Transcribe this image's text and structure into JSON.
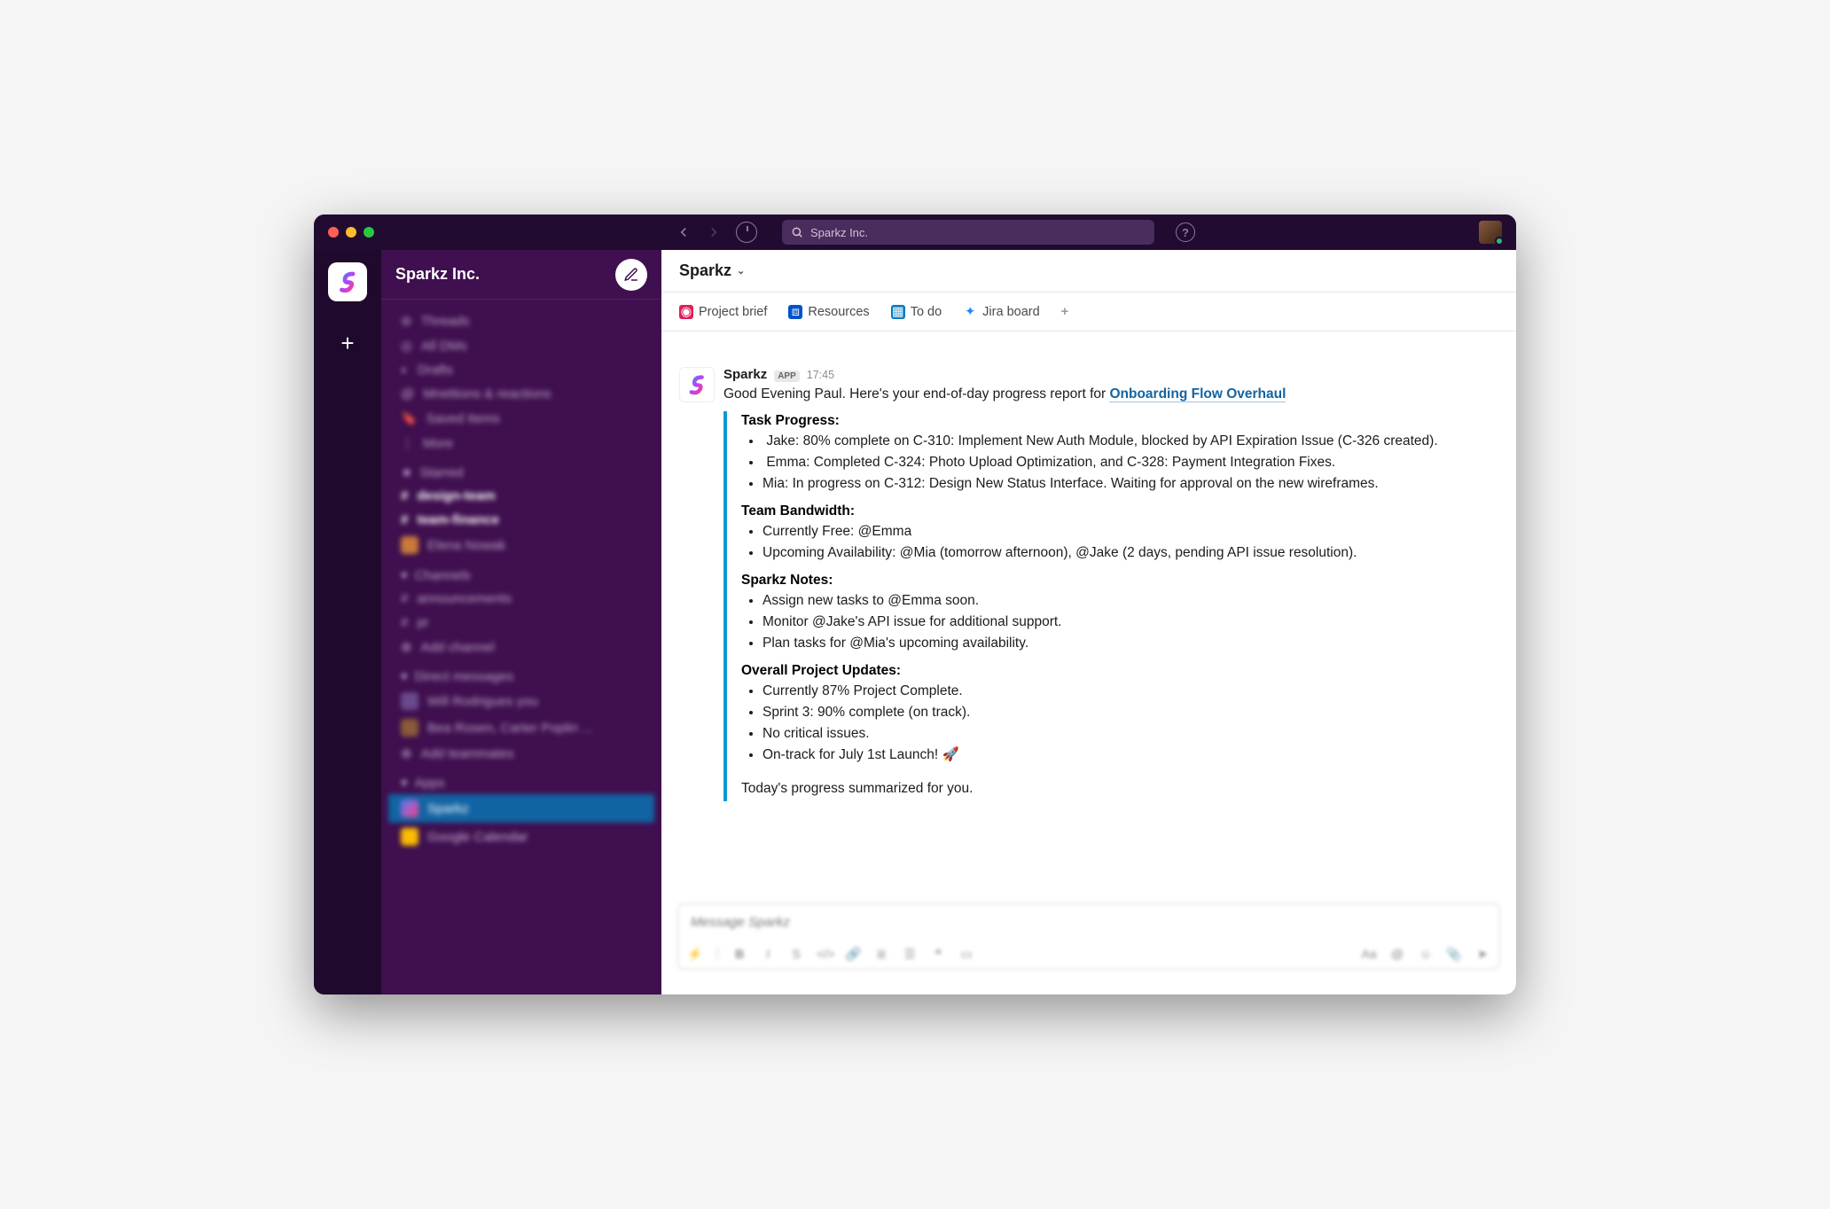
{
  "window": {
    "search_value": "Sparkz Inc."
  },
  "workspace": {
    "name": "Sparkz Inc."
  },
  "sidebar_blur": {
    "system": [
      "Threads",
      "All DMs",
      "Drafts",
      "Mnettions & reactions",
      "Saved Items",
      "More"
    ],
    "starred_header": "Starred",
    "starred": [
      "design-team",
      "team-finance",
      "Elena Nowak"
    ],
    "channels_header": "Channels",
    "channels": [
      "announcements",
      "pr",
      "Add channel"
    ],
    "dms_header": "Direct messages",
    "dms": [
      "Will Rodrigues you",
      "Bea Rosen, Carter Poplin ...",
      "Add teammates"
    ],
    "apps_header": "Apps",
    "apps": [
      "Sparkz",
      "Google Calendar"
    ]
  },
  "channel": {
    "name": "Sparkz"
  },
  "tabs": {
    "brief": "Project brief",
    "resources": "Resources",
    "todo": "To do",
    "jira": "Jira board"
  },
  "message": {
    "sender": "Sparkz",
    "badge": "APP",
    "time": "17:45",
    "greeting_prefix": "Good Evening Paul. Here's your end-of-day progress report for ",
    "greeting_link": "Onboarding Flow Overhaul",
    "sections": {
      "task_progress": {
        "title": "Task Progress:",
        "jake_pre": "Jake: 80% complete on ",
        "jake_link1": "C-310: Implement New Auth Module",
        "jake_mid": ", blocked by API Expiration Issue (",
        "jake_link2": "C-326",
        "jake_post": " created).",
        "emma_pre": "Emma: Completed ",
        "emma_link1": "C-324: Photo Upload Optimization",
        "emma_mid": ", and  ",
        "emma_link2": "C-328: Payment Integration Fixes.",
        "mia_pre": "Mia: In progress on",
        "mia_link": " C-312: Design New Status Interface",
        "mia_post": ". Waiting for approval on the new wireframes."
      },
      "bandwidth": {
        "title": "Team Bandwidth:",
        "free_pre": "Currently Free: ",
        "free_mention": "@Emma",
        "upcoming_pre": "Upcoming Availability: ",
        "upcoming_mention": "@Mia",
        "upcoming_post": " (tomorrow afternoon), @Jake (2 days, pending API issue resolution)."
      },
      "notes": {
        "title": "Sparkz Notes:",
        "n1_pre": "Assign new tasks to ",
        "n1_mention": "@Emma",
        "n1_post": " soon.",
        "n2_pre": "Monitor ",
        "n2_mention": "@Jake",
        "n2_post": "'s API issue for additional support.",
        "n3_pre": "Plan tasks for ",
        "n3_mention": "@Mia",
        "n3_post": "'s upcoming availability."
      },
      "updates": {
        "title": "Overall Project Updates:",
        "u1": "Currently 87% Project Complete.",
        "u2": "Sprint 3: 90% complete (on track).",
        "u3": "No critical issues.",
        "u4": "On-track for July 1st Launch! 🚀"
      }
    },
    "footer": "Today's progress summarized for you."
  },
  "composer": {
    "placeholder": "Message Sparkz"
  }
}
